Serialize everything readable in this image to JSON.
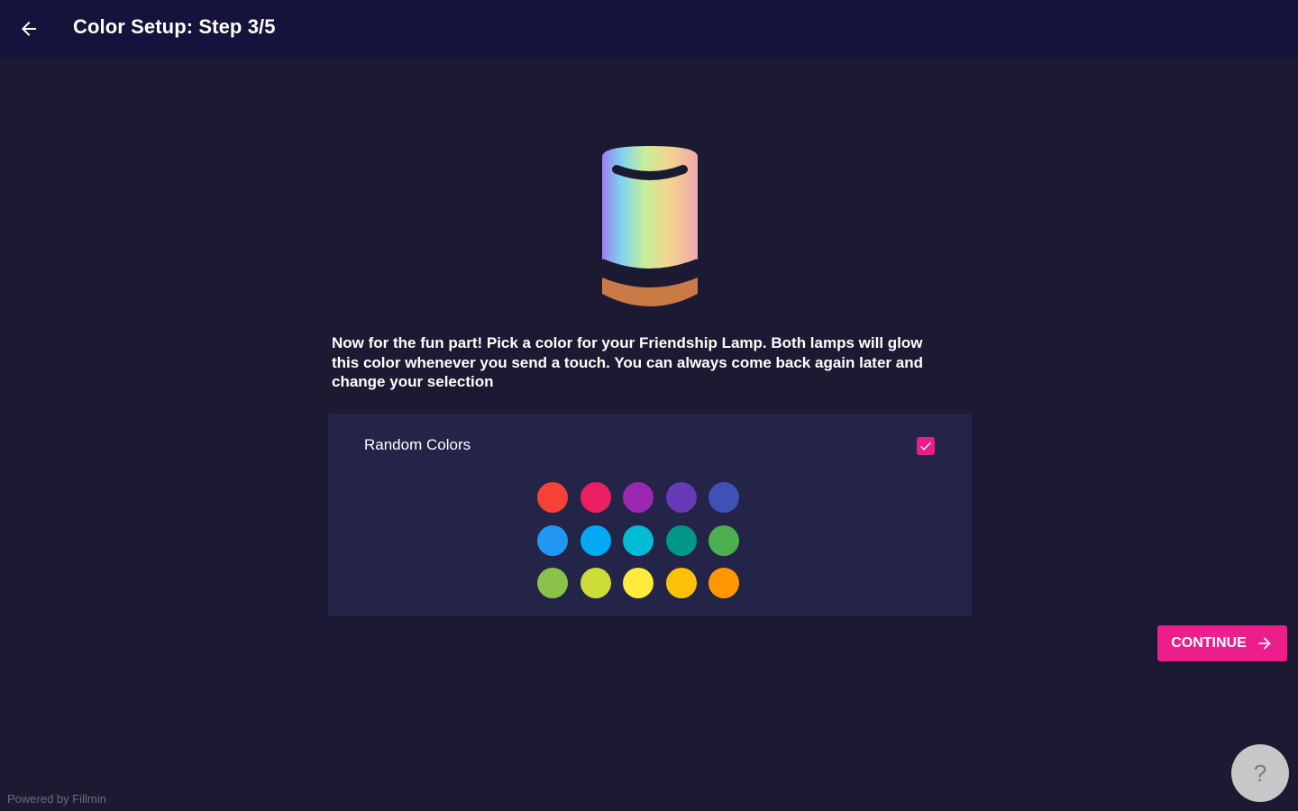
{
  "header": {
    "title": "Color Setup: Step 3/5"
  },
  "main": {
    "description": "Now for the fun part! Pick a color for your Friendship Lamp. Both lamps will glow this color whenever you send a touch. You can always come back again later and change your selection"
  },
  "color_card": {
    "random_colors_label": "Random Colors",
    "random_colors_checked": true,
    "swatches": [
      "#f44336",
      "#e91e63",
      "#9c27b0",
      "#673ab7",
      "#3f51b5",
      "#2196f3",
      "#03a9f4",
      "#00bcd4",
      "#009688",
      "#4caf50",
      "#8bc34a",
      "#cddc39",
      "#ffeb3b",
      "#ffc107",
      "#ff9800"
    ]
  },
  "actions": {
    "continue_label": "CONTINUE",
    "help_label": "?"
  },
  "footer": {
    "powered_by": "Powered by Fillmin"
  },
  "colors": {
    "background": "#1c1a33",
    "appbar": "#15123b",
    "card": "#232448",
    "accent": "#ec1e8c"
  },
  "icons": {
    "back": "arrow-left-icon",
    "checkbox": "check-icon",
    "continue": "arrow-right-icon",
    "lamp": "lamp-icon"
  }
}
